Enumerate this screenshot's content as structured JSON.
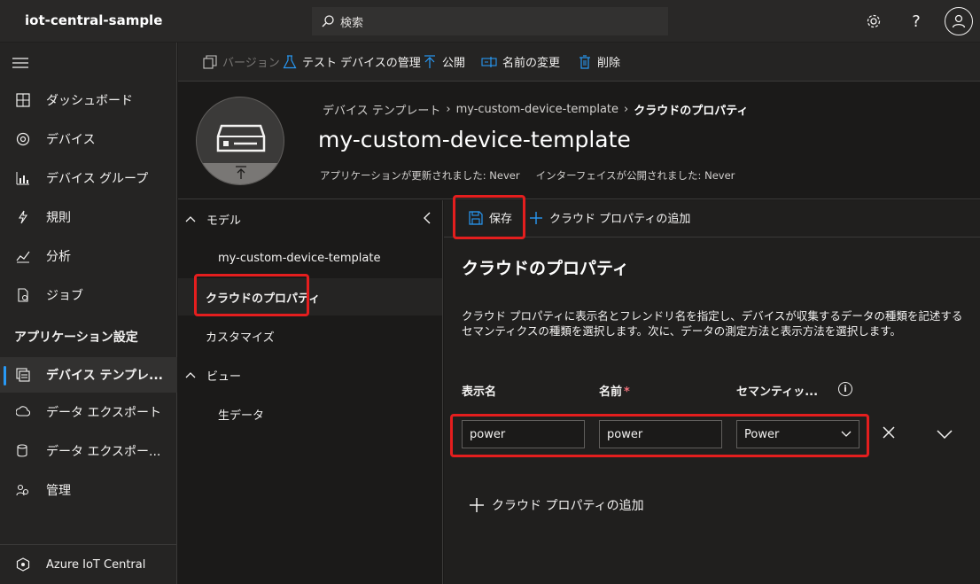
{
  "app": {
    "title": "iot-central-sample"
  },
  "search": {
    "placeholder": "検索"
  },
  "nav": {
    "items": [
      {
        "label": "ダッシュボード"
      },
      {
        "label": "デバイス"
      },
      {
        "label": "デバイス グループ"
      },
      {
        "label": "規則"
      },
      {
        "label": "分析"
      },
      {
        "label": "ジョブ"
      }
    ],
    "section_label": "アプリケーション設定",
    "settings_items": [
      {
        "label": "デバイス テンプレ..."
      },
      {
        "label": "データ エクスポート"
      },
      {
        "label": "データ エクスポー..."
      },
      {
        "label": "管理"
      }
    ],
    "footer_label": "Azure IoT Central"
  },
  "commands": {
    "version": "バージョン",
    "manage_test": "テスト デバイスの管理",
    "publish": "公開",
    "rename": "名前の変更",
    "delete": "削除"
  },
  "header": {
    "breadcrumb": [
      "デバイス テンプレート",
      "my-custom-device-template",
      "クラウドのプロパティ"
    ],
    "title": "my-custom-device-template",
    "app_updated": "アプリケーションが更新されました: Never",
    "interface_published": "インターフェイスが公開されました: Never"
  },
  "tree": {
    "model_label": "モデル",
    "template_label": "my-custom-device-template",
    "cloud_props_label": "クラウドのプロパティ",
    "customize_label": "カスタマイズ",
    "views_label": "ビュー",
    "raw_data_label": "生データ"
  },
  "main": {
    "save_label": "保存",
    "add_prop_label": "クラウド プロパティの追加",
    "title": "クラウドのプロパティ",
    "description": "クラウド プロパティに表示名とフレンドリ名を指定し、デバイスが収集するデータの種類を記述するセマンティクスの種類を選択します。次に、データの測定方法と表示方法を選択します。",
    "col_display_name": "表示名",
    "col_name": "名前",
    "col_name_required": "*",
    "col_semantic": "セマンティッ...",
    "row": {
      "display_name": "power",
      "name": "power",
      "semantic": "Power"
    },
    "add_bottom_label": "クラウド プロパティの追加"
  },
  "colors": {
    "accent": "#2899f5",
    "highlight": "#e41e1e",
    "required": "#f1707b"
  }
}
